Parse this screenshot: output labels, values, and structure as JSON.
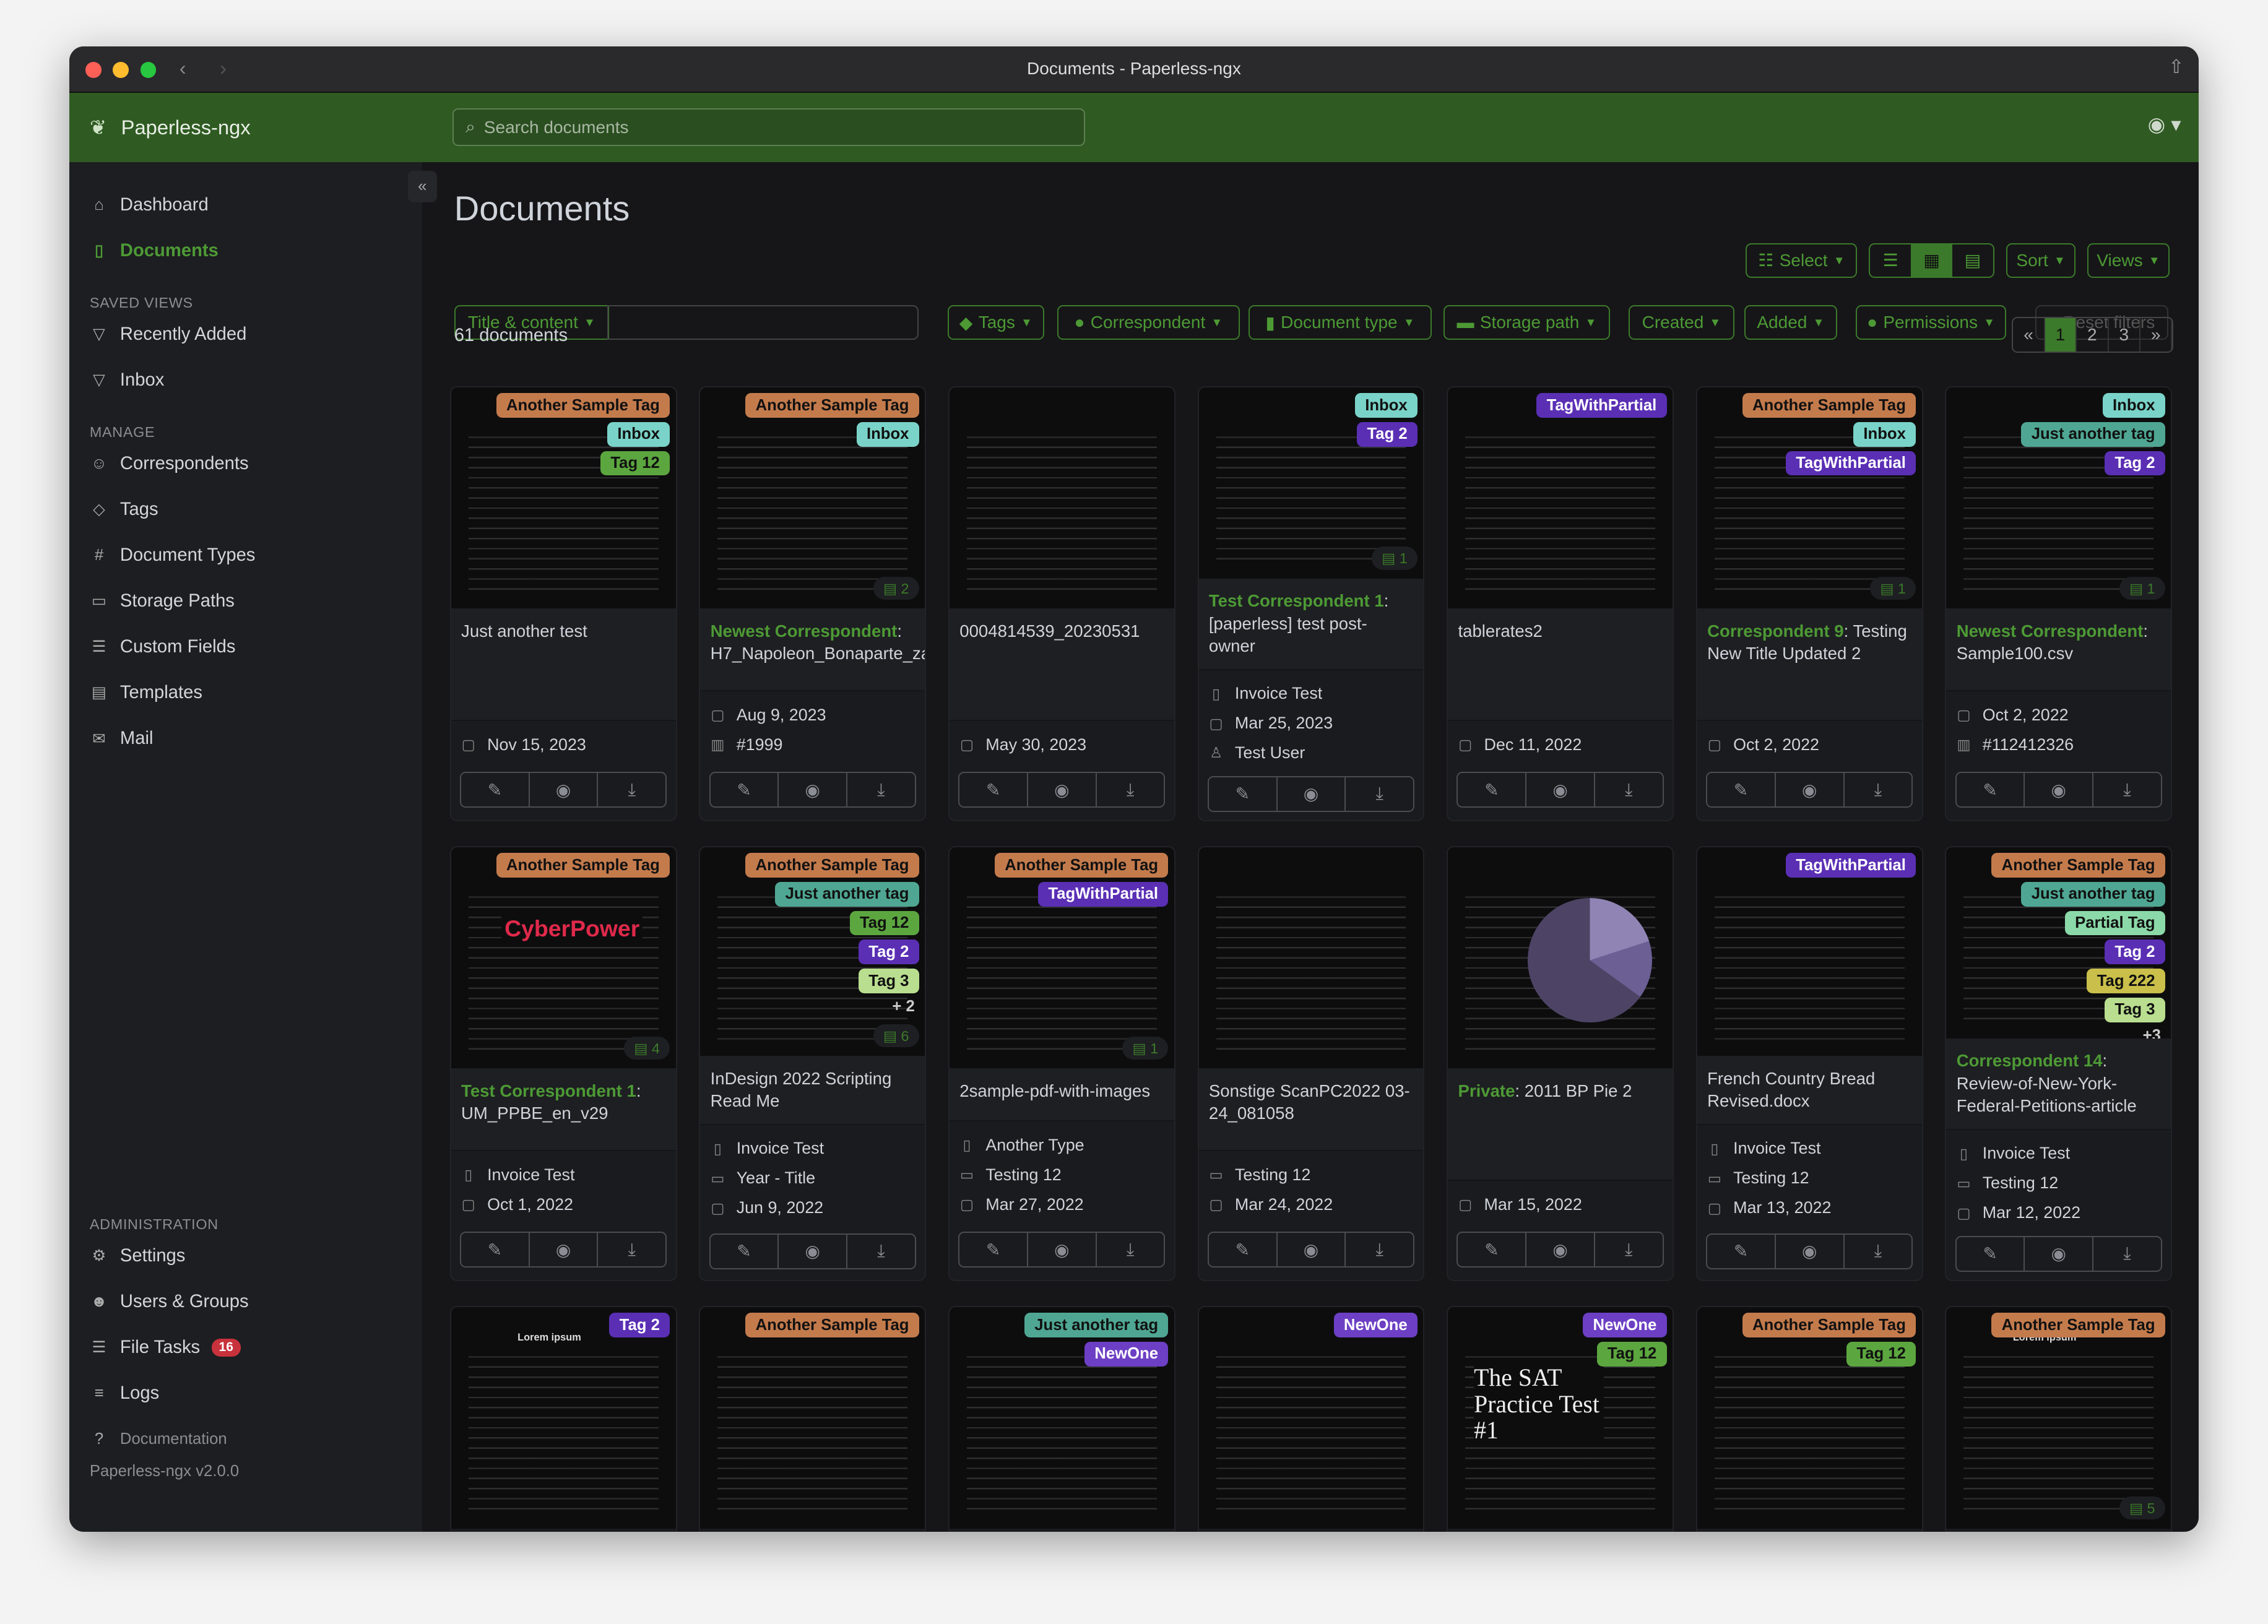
{
  "window": {
    "title": "Documents - Paperless-ngx"
  },
  "header": {
    "brand": "Paperless-ngx",
    "search_placeholder": "Search documents"
  },
  "sidebar": {
    "top": [
      {
        "label": "Dashboard",
        "icon": "house-icon",
        "glyph": "⌂"
      },
      {
        "label": "Documents",
        "icon": "file-icon",
        "glyph": "▯",
        "active": true
      }
    ],
    "saved_views_heading": "SAVED VIEWS",
    "saved_views": [
      {
        "label": "Recently Added",
        "icon": "funnel-icon",
        "glyph": "▽"
      },
      {
        "label": "Inbox",
        "icon": "funnel-icon",
        "glyph": "▽"
      }
    ],
    "manage_heading": "MANAGE",
    "manage": [
      {
        "label": "Correspondents",
        "icon": "person-icon",
        "glyph": "☺"
      },
      {
        "label": "Tags",
        "icon": "tag-icon",
        "glyph": "◇"
      },
      {
        "label": "Document Types",
        "icon": "hash-icon",
        "glyph": "#"
      },
      {
        "label": "Storage Paths",
        "icon": "folder-icon",
        "glyph": "▭"
      },
      {
        "label": "Custom Fields",
        "icon": "ui-checks-icon",
        "glyph": "☰"
      },
      {
        "label": "Templates",
        "icon": "file-text-icon",
        "glyph": "▤"
      },
      {
        "label": "Mail",
        "icon": "envelope-icon",
        "glyph": "✉"
      }
    ],
    "admin_heading": "ADMINISTRATION",
    "admin": [
      {
        "label": "Settings",
        "icon": "gear-icon",
        "glyph": "⚙"
      },
      {
        "label": "Users & Groups",
        "icon": "people-icon",
        "glyph": "☻"
      },
      {
        "label": "File Tasks",
        "icon": "list-task-icon",
        "glyph": "☰",
        "badge": "16"
      },
      {
        "label": "Logs",
        "icon": "list-icon",
        "glyph": "≡"
      }
    ],
    "documentation": "Documentation",
    "version": "Paperless-ngx v2.0.0"
  },
  "main": {
    "title": "Documents",
    "toolbar": {
      "select": "Select",
      "sort": "Sort",
      "views": "Views"
    },
    "filters": {
      "title_content": "Title & content",
      "tags": "Tags",
      "correspondent": "Correspondent",
      "document_type": "Document type",
      "storage_path": "Storage path",
      "created": "Created",
      "added": "Added",
      "permissions": "Permissions",
      "reset": "× Reset filters"
    },
    "count": "61 documents",
    "pages": [
      "«",
      "1",
      "2",
      "3",
      "»"
    ],
    "current_page": "1"
  },
  "tag_colors": {
    "Another Sample Tag": "#c47b4c",
    "Inbox": "#7ad3c8",
    "Tag 12": "#5ca63f",
    "Tag 2": "#5a2fb4",
    "TagWithPartial": "#5a2fb4",
    "Just another tag": "#4fa793",
    "Tag 3": "#b9de8f",
    "Partial Tag": "#8bd9a8",
    "Tag 222": "#c9bf4a",
    "NewOne": "#6c3fc4"
  },
  "light_text_tags": [
    "Tag 2",
    "TagWithPartial",
    "NewOne"
  ],
  "documents": [
    {
      "tags": [
        "Another Sample Tag",
        "Inbox",
        "Tag 12"
      ],
      "title": "Just another test",
      "meta": [
        {
          "icon": "calendar-icon",
          "text": "Nov 15, 2023"
        }
      ]
    },
    {
      "tags": [
        "Another Sample Tag",
        "Inbox"
      ],
      "notes": "2",
      "correspondent": "Newest Correspondent",
      "title": "H7_Napoleon_Bonaparte_zadanie",
      "meta": [
        {
          "icon": "calendar-icon",
          "text": "Aug 9, 2023"
        },
        {
          "icon": "barcode-icon",
          "text": "#1999"
        }
      ]
    },
    {
      "tags": [],
      "title": "0004814539_20230531",
      "meta": [
        {
          "icon": "calendar-icon",
          "text": "May 30, 2023"
        }
      ]
    },
    {
      "tags": [
        "Inbox",
        "Tag 2"
      ],
      "notes": "1",
      "correspondent": "Test Correspondent 1",
      "title": "[paperless] test post-owner",
      "meta": [
        {
          "icon": "file-icon",
          "text": "Invoice Test"
        },
        {
          "icon": "calendar-icon",
          "text": "Mar 25, 2023"
        },
        {
          "icon": "person-lock-icon",
          "text": "Test User"
        }
      ]
    },
    {
      "tags": [
        "TagWithPartial"
      ],
      "title": "tablerates2",
      "meta": [
        {
          "icon": "calendar-icon",
          "text": "Dec 11, 2022"
        }
      ]
    },
    {
      "tags": [
        "Another Sample Tag",
        "Inbox",
        "TagWithPartial"
      ],
      "notes": "1",
      "correspondent": "Correspondent 9",
      "title": "Testing New Title Updated 2",
      "meta": [
        {
          "icon": "calendar-icon",
          "text": "Oct 2, 2022"
        }
      ]
    },
    {
      "tags": [
        "Inbox",
        "Just another tag",
        "Tag 2"
      ],
      "notes": "1",
      "correspondent": "Newest Correspondent",
      "title": "Sample100.csv",
      "meta": [
        {
          "icon": "calendar-icon",
          "text": "Oct 2, 2022"
        },
        {
          "icon": "barcode-icon",
          "text": "#112412326"
        }
      ]
    },
    {
      "tags": [
        "Another Sample Tag"
      ],
      "notes": "4",
      "thumb_text": "CyberPower",
      "correspondent": "Test Correspondent 1",
      "title": "UM_PPBE_en_v29",
      "meta": [
        {
          "icon": "file-icon",
          "text": "Invoice Test"
        },
        {
          "icon": "calendar-icon",
          "text": "Oct 1, 2022"
        }
      ]
    },
    {
      "tags": [
        "Another Sample Tag",
        "Just another tag",
        "Tag 12",
        "Tag 2",
        "Tag 3"
      ],
      "more": "+ 2",
      "notes": "6",
      "title": "InDesign 2022 Scripting Read Me",
      "meta": [
        {
          "icon": "file-icon",
          "text": "Invoice Test"
        },
        {
          "icon": "folder-icon",
          "text": "Year - Title"
        },
        {
          "icon": "calendar-icon",
          "text": "Jun 9, 2022"
        }
      ]
    },
    {
      "tags": [
        "Another Sample Tag",
        "TagWithPartial"
      ],
      "notes": "1",
      "title": "2sample-pdf-with-images",
      "meta": [
        {
          "icon": "file-icon",
          "text": "Another Type"
        },
        {
          "icon": "folder-icon",
          "text": "Testing 12"
        },
        {
          "icon": "calendar-icon",
          "text": "Mar 27, 2022"
        }
      ]
    },
    {
      "tags": [],
      "title": "Sonstige ScanPC2022 03-24_081058",
      "meta": [
        {
          "icon": "folder-icon",
          "text": "Testing 12"
        },
        {
          "icon": "calendar-icon",
          "text": "Mar 24, 2022"
        }
      ]
    },
    {
      "tags": [],
      "thumb_pie": true,
      "correspondent": "Private",
      "title": "2011 BP Pie 2",
      "meta": [
        {
          "icon": "calendar-icon",
          "text": "Mar 15, 2022"
        }
      ]
    },
    {
      "tags": [
        "TagWithPartial"
      ],
      "title": "French Country Bread Revised.docx",
      "meta": [
        {
          "icon": "file-icon",
          "text": "Invoice Test"
        },
        {
          "icon": "folder-icon",
          "text": "Testing 12"
        },
        {
          "icon": "calendar-icon",
          "text": "Mar 13, 2022"
        }
      ]
    },
    {
      "tags": [
        "Another Sample Tag",
        "Just another tag",
        "Partial Tag",
        "Tag 2",
        "Tag 222",
        "Tag 3"
      ],
      "more": "+3",
      "correspondent": "Correspondent 14",
      "title": "Review-of-New-York-Federal-Petitions-article",
      "meta": [
        {
          "icon": "file-icon",
          "text": "Invoice Test"
        },
        {
          "icon": "folder-icon",
          "text": "Testing 12"
        },
        {
          "icon": "calendar-icon",
          "text": "Mar 12, 2022"
        }
      ]
    },
    {
      "tags": [
        "Tag 2"
      ],
      "thumb_text": "Lorem ipsum"
    },
    {
      "tags": [
        "Another Sample Tag"
      ]
    },
    {
      "tags": [
        "Just another tag",
        "NewOne"
      ]
    },
    {
      "tags": [
        "NewOne"
      ]
    },
    {
      "tags": [
        "NewOne",
        "Tag 12"
      ],
      "thumb_text": "The SAT Practice Test #1"
    },
    {
      "tags": [
        "Another Sample Tag",
        "Tag 12"
      ]
    },
    {
      "tags": [
        "Another Sample Tag"
      ],
      "thumb_text": "Lorem ipsum",
      "notes": "5"
    }
  ]
}
